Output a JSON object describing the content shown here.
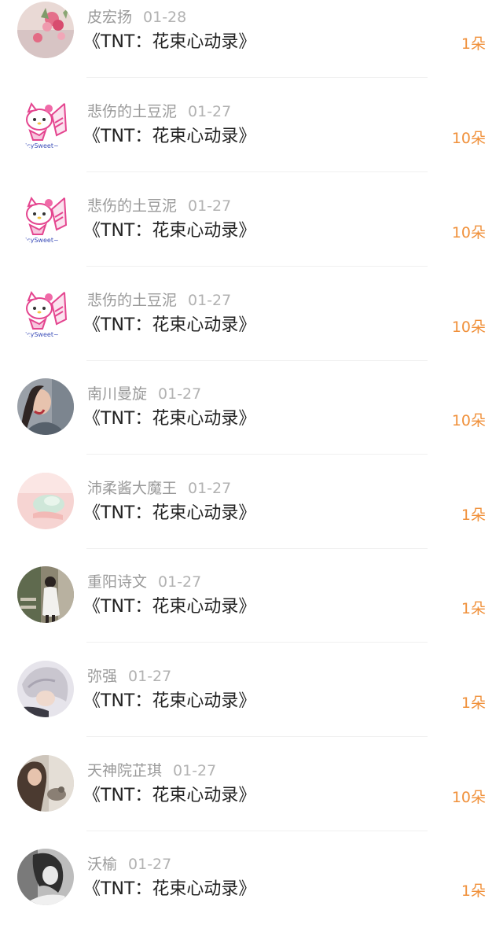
{
  "title_text": "《TNT：花束心动录》",
  "colors": {
    "name": "#9a9a9a",
    "date": "#b2b2b2",
    "title": "#222222",
    "count": "#f0903a",
    "divider": "#f0f0f0"
  },
  "entries": [
    {
      "name": "皮宏扬",
      "date": "01-28",
      "count": "1朵",
      "avatar": "flower-photo-avatar"
    },
    {
      "name": "悲伤的土豆泥",
      "date": "01-27",
      "count": "10朵",
      "avatar": "hello-kitty-avatar"
    },
    {
      "name": "悲伤的土豆泥",
      "date": "01-27",
      "count": "10朵",
      "avatar": "hello-kitty-avatar"
    },
    {
      "name": "悲伤的土豆泥",
      "date": "01-27",
      "count": "10朵",
      "avatar": "hello-kitty-avatar"
    },
    {
      "name": "南川曼旋",
      "date": "01-27",
      "count": "10朵",
      "avatar": "portrait-photo-avatar"
    },
    {
      "name": "沛柔酱大魔王",
      "date": "01-27",
      "count": "1朵",
      "avatar": "pastel-photo-avatar"
    },
    {
      "name": "重阳诗文",
      "date": "01-27",
      "count": "1朵",
      "avatar": "outdoor-photo-avatar"
    },
    {
      "name": "弥强",
      "date": "01-27",
      "count": "1朵",
      "avatar": "grey-hair-photo-avatar"
    },
    {
      "name": "天神院芷琪",
      "date": "01-27",
      "count": "10朵",
      "avatar": "portrait-photo-avatar"
    },
    {
      "name": "沃榆",
      "date": "01-27",
      "count": "1朵",
      "avatar": "bw-photo-avatar"
    }
  ]
}
